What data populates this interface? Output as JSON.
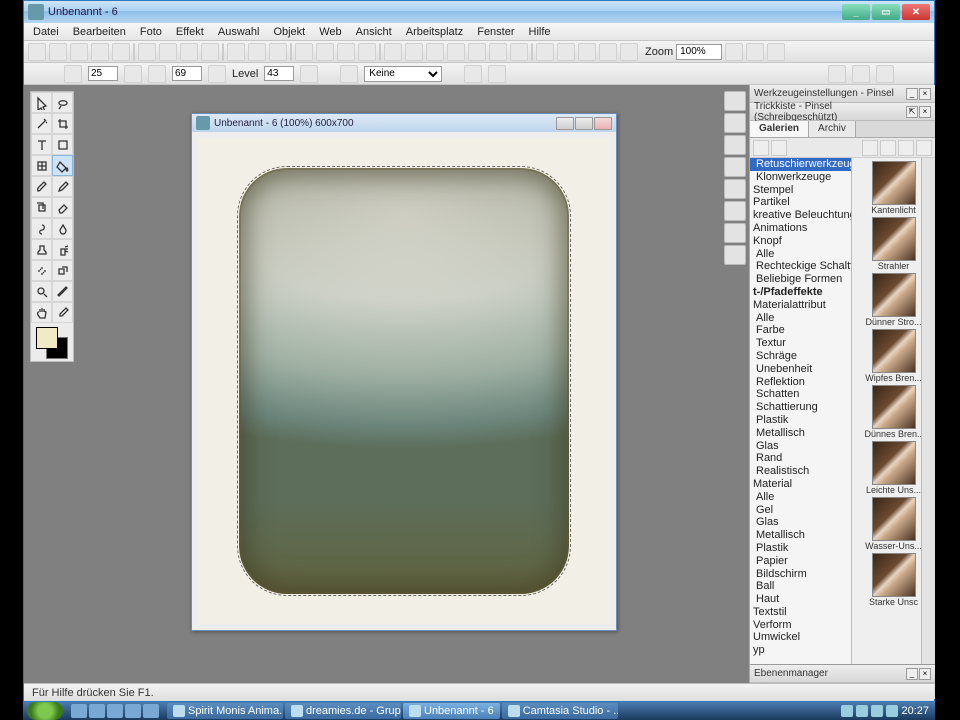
{
  "app": {
    "title": "Unbenannt - 6"
  },
  "window_controls": {
    "min": "_",
    "max": "▭",
    "close": "✕"
  },
  "menu": [
    "Datei",
    "Bearbeiten",
    "Foto",
    "Effekt",
    "Auswahl",
    "Objekt",
    "Web",
    "Ansicht",
    "Arbeitsplatz",
    "Fenster",
    "Hilfe"
  ],
  "toolbar": {
    "zoom_label": "Zoom",
    "zoom_value": "100%"
  },
  "optbar": {
    "v1": "25",
    "v2": "69",
    "level_label": "Level",
    "level_val": "43",
    "preset": "Keine"
  },
  "doc": {
    "title": "Unbenannt - 6 (100%) 600x700"
  },
  "panels": {
    "tools_title": "Werkzeugeinstellungen - Pinsel",
    "trick_title": "Trickkiste - Pinsel (Schreibgeschützt)",
    "tabs": [
      "Galerien",
      "Archiv"
    ],
    "tree": [
      {
        "t": "Retuschierwerkzeuge",
        "lvl": 1,
        "sel": true
      },
      {
        "t": "Klonwerkzeuge",
        "lvl": 1
      },
      {
        "t": "Stempel",
        "lvl": 0
      },
      {
        "t": "Partikel",
        "lvl": 0
      },
      {
        "t": "kreative Beleuchtungs",
        "lvl": 0
      },
      {
        "t": "Animations",
        "lvl": 0
      },
      {
        "t": "Knopf",
        "lvl": 0
      },
      {
        "t": "Alle",
        "lvl": 1
      },
      {
        "t": "Rechteckige Schaltfläc",
        "lvl": 1
      },
      {
        "t": "Beliebige Formen",
        "lvl": 1
      },
      {
        "t": "t-/Pfadeffekte",
        "lvl": 0,
        "bold": true
      },
      {
        "t": "Materialattribut",
        "lvl": 0
      },
      {
        "t": "Alle",
        "lvl": 1
      },
      {
        "t": "Farbe",
        "lvl": 1
      },
      {
        "t": "Textur",
        "lvl": 1
      },
      {
        "t": "Schräge",
        "lvl": 1
      },
      {
        "t": "Unebenheit",
        "lvl": 1
      },
      {
        "t": "Reflektion",
        "lvl": 1
      },
      {
        "t": "Schatten",
        "lvl": 1
      },
      {
        "t": "Schattierung",
        "lvl": 1
      },
      {
        "t": "Plastik",
        "lvl": 1
      },
      {
        "t": "Metallisch",
        "lvl": 1
      },
      {
        "t": "Glas",
        "lvl": 1
      },
      {
        "t": "Rand",
        "lvl": 1
      },
      {
        "t": "Realistisch",
        "lvl": 1
      },
      {
        "t": "Material",
        "lvl": 0
      },
      {
        "t": "Alle",
        "lvl": 1
      },
      {
        "t": "Gel",
        "lvl": 1
      },
      {
        "t": "Glas",
        "lvl": 1
      },
      {
        "t": "Metallisch",
        "lvl": 1
      },
      {
        "t": "Plastik",
        "lvl": 1
      },
      {
        "t": "Papier",
        "lvl": 1
      },
      {
        "t": "Bildschirm",
        "lvl": 1
      },
      {
        "t": "Ball",
        "lvl": 1
      },
      {
        "t": "Haut",
        "lvl": 1
      },
      {
        "t": "Textstil",
        "lvl": 0
      },
      {
        "t": "Verform",
        "lvl": 0
      },
      {
        "t": "Umwickel",
        "lvl": 0
      },
      {
        "t": "yp",
        "lvl": 0
      }
    ],
    "thumbs": [
      "Kantenlicht",
      "Strahler",
      "Dünner Stro...",
      "Wipfes Bren...",
      "Dünnes Bren...",
      "Leichte Uns...",
      "Wasser-Uns...",
      "Starke Unsc"
    ],
    "layers_title": "Ebenenmanager"
  },
  "status": "Für Hilfe drücken Sie F1.",
  "taskbar": {
    "items": [
      "Spirit Monis Anima...",
      "dreamies.de - Grup...",
      "Unbenannt - 6",
      "Camtasia Studio - ..."
    ],
    "active_index": 2,
    "clock": "20:27"
  },
  "tool_icons": [
    "arrow",
    "lasso",
    "wand",
    "crop",
    "text",
    "shape",
    "grid",
    "bucket",
    "brush",
    "pencil",
    "clone",
    "erase",
    "smudge",
    "blur",
    "stamp",
    "spray",
    "dodge",
    "clone2",
    "zoom",
    "measure",
    "hand",
    "eyedrop"
  ]
}
